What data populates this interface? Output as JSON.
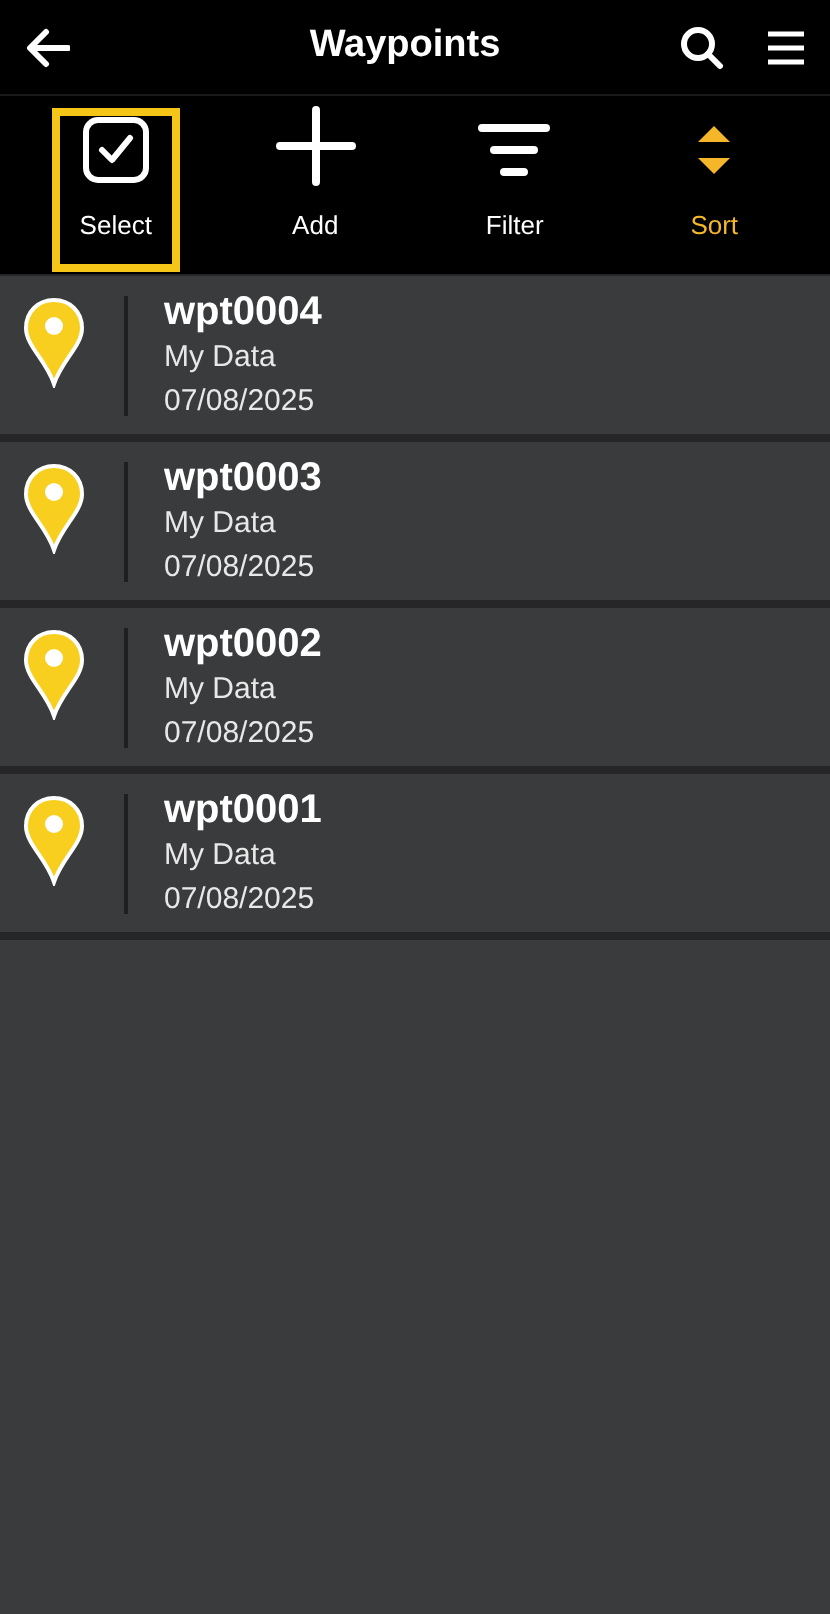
{
  "header": {
    "title": "Waypoints"
  },
  "toolbar": [
    {
      "kind": "select",
      "label": "Select",
      "selected": true,
      "active": false
    },
    {
      "kind": "add",
      "label": "Add",
      "selected": false,
      "active": false
    },
    {
      "kind": "filter",
      "label": "Filter",
      "selected": false,
      "active": false
    },
    {
      "kind": "sort",
      "label": "Sort",
      "selected": false,
      "active": true
    }
  ],
  "waypoints": [
    {
      "name": "wpt0004",
      "source": "My Data",
      "date": "07/08/2025"
    },
    {
      "name": "wpt0003",
      "source": "My Data",
      "date": "07/08/2025"
    },
    {
      "name": "wpt0002",
      "source": "My Data",
      "date": "07/08/2025"
    },
    {
      "name": "wpt0001",
      "source": "My Data",
      "date": "07/08/2025"
    }
  ]
}
